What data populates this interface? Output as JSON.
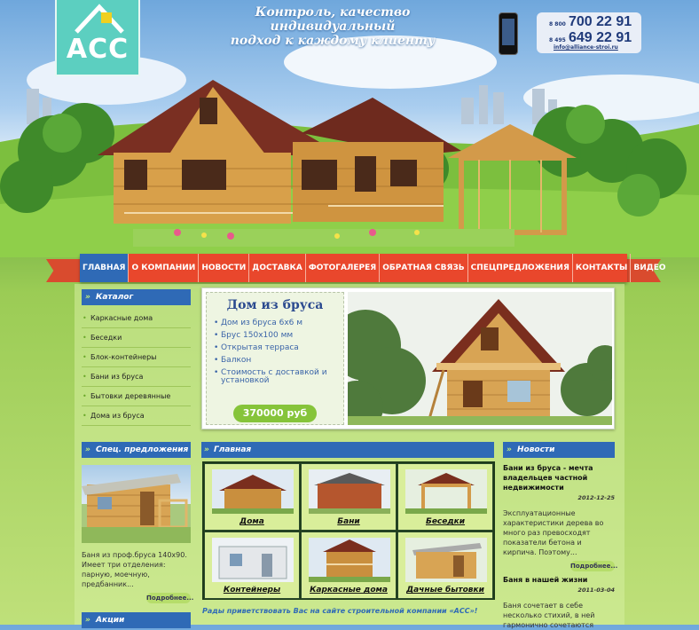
{
  "header": {
    "logo_text": "АСС",
    "slogan_line1": "Контроль, качество индивидуальный",
    "slogan_line2": "подход к каждому клиенту",
    "phones": [
      {
        "code": "8 800",
        "number": "700 22 91"
      },
      {
        "code": "8 495",
        "number": "649 22 91"
      }
    ],
    "email": "info@alliance-stroi.ru"
  },
  "nav": {
    "items": [
      {
        "label": "ГЛАВНАЯ"
      },
      {
        "label": "О КОМПАНИИ"
      },
      {
        "label": "НОВОСТИ"
      },
      {
        "label": "ДОСТАВКА"
      },
      {
        "label": "ФОТОГАЛЕРЕЯ"
      },
      {
        "label": "ОБРАТНАЯ СВЯЗЬ"
      },
      {
        "label": "СПЕЦПРЕДЛОЖЕНИЯ"
      },
      {
        "label": "КОНТАКТЫ"
      },
      {
        "label": "ВИДЕО"
      }
    ]
  },
  "sidebar": {
    "catalog_title": "Каталог",
    "catalog": [
      "Каркасные дома",
      "Беседки",
      "Блок-контейнеры",
      "Бани из бруса",
      "Бытовки деревянные",
      "Дома из бруса"
    ],
    "spec_title": "Спец. предложения",
    "spec_text": "Баня из проф.бруса 140х90. Имеет три отделения: парную, моечную, предбанник...",
    "more_label": "Подробнее...",
    "promo_title": "Акции"
  },
  "banner": {
    "title": "Дом из бруса",
    "features": [
      "Дом из бруса 6х6 м",
      "Брус 150х100 мм",
      "Открытая терраса",
      "Балкон",
      "Стоимость с доставкой и установкой"
    ],
    "price": "370000 руб"
  },
  "main": {
    "section_title": "Главная",
    "tiles": [
      "Дома",
      "Бани",
      "Беседки",
      "Контейнеры",
      "Каркасные дома",
      "Дачные бытовки"
    ],
    "welcome": "Рады приветствовать Вас на сайте строительной компании «АСС»!"
  },
  "news": {
    "title": "Новости",
    "items": [
      {
        "title": "Бани из бруса - мечта владельцев частной недвижимости",
        "date": "2012-12-25",
        "text": "Эксплуатационные характеристики дерева во много раз превосходят показатели бетона и кирпича. Поэтому..."
      },
      {
        "title": "Баня в нашей жизни",
        "date": "2011-03-04",
        "text": "Баня сочетает в себе несколько стихий, в ней гармонично сочетаются"
      }
    ],
    "more_label": "Подробнее..."
  },
  "colors": {
    "nav_bg": "#e9472c",
    "nav_active": "#2f6ab6",
    "panel_head": "#2f6ab6",
    "price_badge": "#86c43a",
    "logo_bg": "#5ccfc0"
  }
}
